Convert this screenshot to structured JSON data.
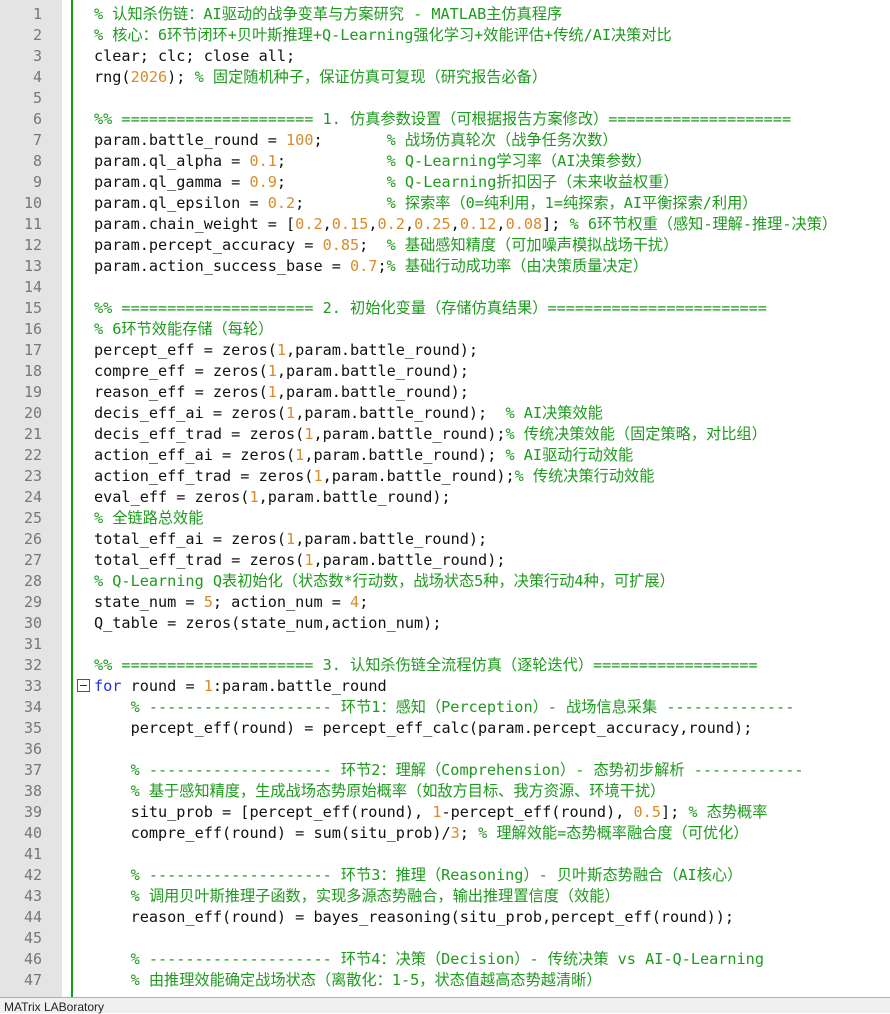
{
  "editor": {
    "lines": [
      {
        "n": "1",
        "t": [
          {
            "c": "cmt",
            "s": "% 认知杀伤链：AI驱动的战争变革与方案研究 - MATLAB主仿真程序"
          }
        ]
      },
      {
        "n": "2",
        "t": [
          {
            "c": "cmt",
            "s": "% 核心：6环节闭环+贝叶斯推理+Q-Learning强化学习+效能评估+传统/AI决策对比"
          }
        ]
      },
      {
        "n": "3",
        "t": [
          {
            "c": "txt",
            "s": "clear; clc; close all;"
          }
        ]
      },
      {
        "n": "4",
        "t": [
          {
            "c": "txt",
            "s": "rng("
          },
          {
            "c": "num",
            "s": "2026"
          },
          {
            "c": "txt",
            "s": "); "
          },
          {
            "c": "cmt",
            "s": "% 固定随机种子，保证仿真可复现（研究报告必备）"
          }
        ]
      },
      {
        "n": "5",
        "t": []
      },
      {
        "n": "6",
        "t": [
          {
            "c": "cmt",
            "s": "%% ===================== 1. 仿真参数设置（可根据报告方案修改）===================="
          }
        ]
      },
      {
        "n": "7",
        "t": [
          {
            "c": "txt",
            "s": "param.battle_round = "
          },
          {
            "c": "num",
            "s": "100"
          },
          {
            "c": "txt",
            "s": ";       "
          },
          {
            "c": "cmt",
            "s": "% 战场仿真轮次（战争任务次数）"
          }
        ]
      },
      {
        "n": "8",
        "t": [
          {
            "c": "txt",
            "s": "param.ql_alpha = "
          },
          {
            "c": "num",
            "s": "0.1"
          },
          {
            "c": "txt",
            "s": ";           "
          },
          {
            "c": "cmt",
            "s": "% Q-Learning学习率（AI决策参数）"
          }
        ]
      },
      {
        "n": "9",
        "t": [
          {
            "c": "txt",
            "s": "param.ql_gamma = "
          },
          {
            "c": "num",
            "s": "0.9"
          },
          {
            "c": "txt",
            "s": ";           "
          },
          {
            "c": "cmt",
            "s": "% Q-Learning折扣因子（未来收益权重）"
          }
        ]
      },
      {
        "n": "10",
        "t": [
          {
            "c": "txt",
            "s": "param.ql_epsilon = "
          },
          {
            "c": "num",
            "s": "0.2"
          },
          {
            "c": "txt",
            "s": ";         "
          },
          {
            "c": "cmt",
            "s": "% 探索率（0=纯利用，1=纯探索，AI平衡探索/利用）"
          }
        ]
      },
      {
        "n": "11",
        "t": [
          {
            "c": "txt",
            "s": "param.chain_weight = ["
          },
          {
            "c": "num",
            "s": "0.2"
          },
          {
            "c": "txt",
            "s": ","
          },
          {
            "c": "num",
            "s": "0.15"
          },
          {
            "c": "txt",
            "s": ","
          },
          {
            "c": "num",
            "s": "0.2"
          },
          {
            "c": "txt",
            "s": ","
          },
          {
            "c": "num",
            "s": "0.25"
          },
          {
            "c": "txt",
            "s": ","
          },
          {
            "c": "num",
            "s": "0.12"
          },
          {
            "c": "txt",
            "s": ","
          },
          {
            "c": "num",
            "s": "0.08"
          },
          {
            "c": "txt",
            "s": "]; "
          },
          {
            "c": "cmt",
            "s": "% 6环节权重（感知-理解-推理-决策）"
          }
        ]
      },
      {
        "n": "12",
        "t": [
          {
            "c": "txt",
            "s": "param.percept_accuracy = "
          },
          {
            "c": "num",
            "s": "0.85"
          },
          {
            "c": "txt",
            "s": ";  "
          },
          {
            "c": "cmt",
            "s": "% 基础感知精度（可加噪声模拟战场干扰）"
          }
        ]
      },
      {
        "n": "13",
        "t": [
          {
            "c": "txt",
            "s": "param.action_success_base = "
          },
          {
            "c": "num",
            "s": "0.7"
          },
          {
            "c": "txt",
            "s": ";"
          },
          {
            "c": "cmt",
            "s": "% 基础行动成功率（由决策质量决定）"
          }
        ]
      },
      {
        "n": "14",
        "t": []
      },
      {
        "n": "15",
        "t": [
          {
            "c": "cmt",
            "s": "%% ===================== 2. 初始化变量（存储仿真结果）========================"
          }
        ]
      },
      {
        "n": "16",
        "t": [
          {
            "c": "cmt",
            "s": "% 6环节效能存储（每轮）"
          }
        ]
      },
      {
        "n": "17",
        "t": [
          {
            "c": "txt",
            "s": "percept_eff = zeros("
          },
          {
            "c": "num",
            "s": "1"
          },
          {
            "c": "txt",
            "s": ",param.battle_round);"
          }
        ]
      },
      {
        "n": "18",
        "t": [
          {
            "c": "txt",
            "s": "compre_eff = zeros("
          },
          {
            "c": "num",
            "s": "1"
          },
          {
            "c": "txt",
            "s": ",param.battle_round);"
          }
        ]
      },
      {
        "n": "19",
        "t": [
          {
            "c": "txt",
            "s": "reason_eff = zeros("
          },
          {
            "c": "num",
            "s": "1"
          },
          {
            "c": "txt",
            "s": ",param.battle_round);"
          }
        ]
      },
      {
        "n": "20",
        "t": [
          {
            "c": "txt",
            "s": "decis_eff_ai = zeros("
          },
          {
            "c": "num",
            "s": "1"
          },
          {
            "c": "txt",
            "s": ",param.battle_round);  "
          },
          {
            "c": "cmt",
            "s": "% AI决策效能"
          }
        ]
      },
      {
        "n": "21",
        "t": [
          {
            "c": "txt",
            "s": "decis_eff_trad = zeros("
          },
          {
            "c": "num",
            "s": "1"
          },
          {
            "c": "txt",
            "s": ",param.battle_round);"
          },
          {
            "c": "cmt",
            "s": "% 传统决策效能（固定策略，对比组）"
          }
        ]
      },
      {
        "n": "22",
        "t": [
          {
            "c": "txt",
            "s": "action_eff_ai = zeros("
          },
          {
            "c": "num",
            "s": "1"
          },
          {
            "c": "txt",
            "s": ",param.battle_round); "
          },
          {
            "c": "cmt",
            "s": "% AI驱动行动效能"
          }
        ]
      },
      {
        "n": "23",
        "t": [
          {
            "c": "txt",
            "s": "action_eff_trad = zeros("
          },
          {
            "c": "num",
            "s": "1"
          },
          {
            "c": "txt",
            "s": ",param.battle_round);"
          },
          {
            "c": "cmt",
            "s": "% 传统决策行动效能"
          }
        ]
      },
      {
        "n": "24",
        "t": [
          {
            "c": "txt",
            "s": "eval_eff = zeros("
          },
          {
            "c": "num",
            "s": "1"
          },
          {
            "c": "txt",
            "s": ",param.battle_round);"
          }
        ]
      },
      {
        "n": "25",
        "t": [
          {
            "c": "cmt",
            "s": "% 全链路总效能"
          }
        ]
      },
      {
        "n": "26",
        "t": [
          {
            "c": "txt",
            "s": "total_eff_ai = zeros("
          },
          {
            "c": "num",
            "s": "1"
          },
          {
            "c": "txt",
            "s": ",param.battle_round);"
          }
        ]
      },
      {
        "n": "27",
        "t": [
          {
            "c": "txt",
            "s": "total_eff_trad = zeros("
          },
          {
            "c": "num",
            "s": "1"
          },
          {
            "c": "txt",
            "s": ",param.battle_round);"
          }
        ]
      },
      {
        "n": "28",
        "t": [
          {
            "c": "cmt",
            "s": "% Q-Learning Q表初始化（状态数*行动数，战场状态5种，决策行动4种，可扩展）"
          }
        ]
      },
      {
        "n": "29",
        "t": [
          {
            "c": "txt",
            "s": "state_num = "
          },
          {
            "c": "num",
            "s": "5"
          },
          {
            "c": "txt",
            "s": "; action_num = "
          },
          {
            "c": "num",
            "s": "4"
          },
          {
            "c": "txt",
            "s": ";"
          }
        ]
      },
      {
        "n": "30",
        "t": [
          {
            "c": "txt",
            "s": "Q_table = zeros(state_num,action_num);"
          }
        ]
      },
      {
        "n": "31",
        "t": []
      },
      {
        "n": "32",
        "t": [
          {
            "c": "cmt",
            "s": "%% ===================== 3. 认知杀伤链全流程仿真（逐轮迭代）=================="
          }
        ]
      },
      {
        "n": "33",
        "fold": true,
        "t": [
          {
            "c": "kw",
            "s": "for"
          },
          {
            "c": "txt",
            "s": " round = "
          },
          {
            "c": "num",
            "s": "1"
          },
          {
            "c": "txt",
            "s": ":param.battle_round"
          }
        ]
      },
      {
        "n": "34",
        "t": [
          {
            "c": "txt",
            "s": "    "
          },
          {
            "c": "cmt",
            "s": "% -------------------- 环节1：感知（Perception）- 战场信息采集 --------------"
          }
        ]
      },
      {
        "n": "35",
        "t": [
          {
            "c": "txt",
            "s": "    percept_eff(round) = percept_eff_calc(param.percept_accuracy,round);"
          }
        ]
      },
      {
        "n": "36",
        "t": []
      },
      {
        "n": "37",
        "t": [
          {
            "c": "txt",
            "s": "    "
          },
          {
            "c": "cmt",
            "s": "% -------------------- 环节2：理解（Comprehension）- 态势初步解析 ------------"
          }
        ]
      },
      {
        "n": "38",
        "t": [
          {
            "c": "txt",
            "s": "    "
          },
          {
            "c": "cmt",
            "s": "% 基于感知精度，生成战场态势原始概率（如敌方目标、我方资源、环境干扰）"
          }
        ]
      },
      {
        "n": "39",
        "t": [
          {
            "c": "txt",
            "s": "    situ_prob = [percept_eff(round), "
          },
          {
            "c": "num",
            "s": "1"
          },
          {
            "c": "txt",
            "s": "-percept_eff(round), "
          },
          {
            "c": "num",
            "s": "0.5"
          },
          {
            "c": "txt",
            "s": "]; "
          },
          {
            "c": "cmt",
            "s": "% 态势概率"
          }
        ]
      },
      {
        "n": "40",
        "t": [
          {
            "c": "txt",
            "s": "    compre_eff(round) = sum(situ_prob)/"
          },
          {
            "c": "num",
            "s": "3"
          },
          {
            "c": "txt",
            "s": "; "
          },
          {
            "c": "cmt",
            "s": "% 理解效能=态势概率融合度（可优化）"
          }
        ]
      },
      {
        "n": "41",
        "t": []
      },
      {
        "n": "42",
        "t": [
          {
            "c": "txt",
            "s": "    "
          },
          {
            "c": "cmt",
            "s": "% -------------------- 环节3：推理（Reasoning）- 贝叶斯态势融合（AI核心）"
          }
        ]
      },
      {
        "n": "43",
        "t": [
          {
            "c": "txt",
            "s": "    "
          },
          {
            "c": "cmt",
            "s": "% 调用贝叶斯推理子函数，实现多源态势融合，输出推理置信度（效能）"
          }
        ]
      },
      {
        "n": "44",
        "t": [
          {
            "c": "txt",
            "s": "    reason_eff(round) = bayes_reasoning(situ_prob,percept_eff(round));"
          }
        ]
      },
      {
        "n": "45",
        "t": []
      },
      {
        "n": "46",
        "t": [
          {
            "c": "txt",
            "s": "    "
          },
          {
            "c": "cmt",
            "s": "% -------------------- 环节4：决策（Decision）- 传统决策 vs AI-Q-Learning"
          }
        ]
      },
      {
        "n": "47",
        "t": [
          {
            "c": "txt",
            "s": "    "
          },
          {
            "c": "cmt",
            "s": "% 由推理效能确定战场状态（离散化：1-5，状态值越高态势越清晰）"
          }
        ]
      }
    ]
  },
  "status": {
    "text": "MATrix LABoratory"
  },
  "colors": {
    "comment": "#1e9a1e",
    "number": "#d88b2a",
    "keyword": "#1f32d6",
    "text": "#111111",
    "gutter": "#e4e4e4",
    "fold_line": "#0fa30f"
  }
}
